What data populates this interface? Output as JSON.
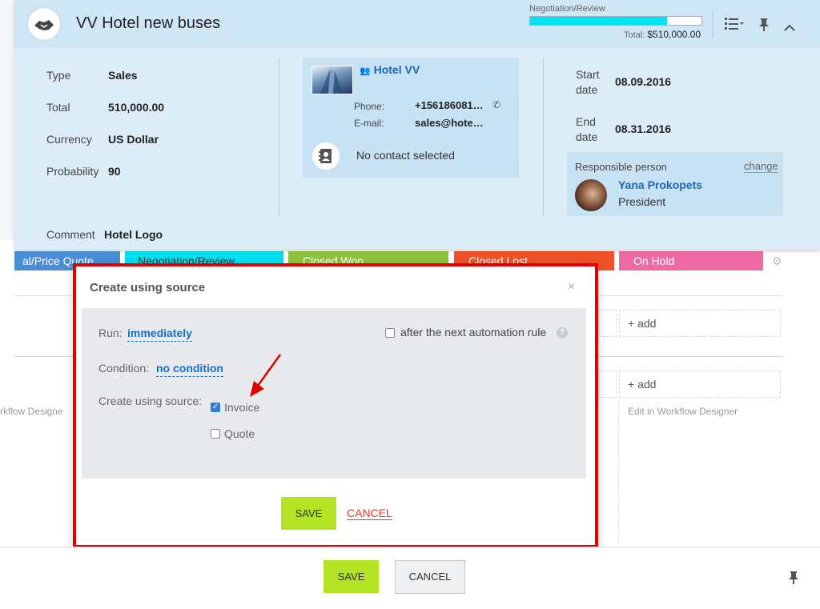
{
  "header": {
    "title": "VV Hotel new buses",
    "stage_label": "Negotiation/Review",
    "progress_fraction": 0.8,
    "total_prefix": "Total:",
    "total_value": "$510,000.00",
    "icons": [
      "list-view-icon",
      "pin-icon",
      "collapse-chevron-icon"
    ]
  },
  "details": {
    "type_label": "Type",
    "type_value": "Sales",
    "total_label": "Total",
    "total_value": "510,000.00",
    "currency_label": "Currency",
    "currency_value": "US Dollar",
    "probability_label": "Probability",
    "probability_value": "90",
    "comment_label": "Comment",
    "comment_value": "Hotel Logo"
  },
  "contact": {
    "company": "Hotel VV",
    "phone_label": "Phone:",
    "phone_value": "+156186081…",
    "email_label": "E-mail:",
    "email_value": "sales@hote…",
    "no_contact": "No contact selected"
  },
  "dates": {
    "start_label": "Start date",
    "start_value": "08.09.2016",
    "end_label": "End date",
    "end_value": "08.31.2016"
  },
  "responsible": {
    "label": "Responsible person",
    "change": "change",
    "name": "Yana Prokopets",
    "role": "President"
  },
  "stages": [
    {
      "label": "al/Price Quote",
      "color": "#4a8fd6"
    },
    {
      "label": "Negotiation/Review",
      "color": "#00dff0"
    },
    {
      "label": "Closed Won",
      "color": "#8fc43c"
    },
    {
      "label": "Closed Lost",
      "color": "#f0522a"
    },
    {
      "label": "On Hold",
      "color": "#ee6aa4"
    }
  ],
  "background": {
    "add1": "+ add",
    "add2": "+ add",
    "wf_left": "rkflow Designe",
    "wf_right": "Edit in Workflow Designer"
  },
  "modal": {
    "title": "Create using source",
    "close": "×",
    "run_label": "Run:",
    "run_value": "immediately",
    "after_rule": "after the next automation rule",
    "help": "?",
    "condition_label": "Condition:",
    "condition_value": "no condition",
    "source_label": "Create using source:",
    "option_invoice": "Invoice",
    "option_invoice_checked": true,
    "option_quote": "Quote",
    "option_quote_checked": false,
    "save": "SAVE",
    "cancel": "CANCEL"
  },
  "footer": {
    "save": "SAVE",
    "cancel": "CANCEL"
  },
  "colors": {
    "accent_green": "#b3e322",
    "highlight_red": "#e00000",
    "link_blue": "#1967b5"
  }
}
